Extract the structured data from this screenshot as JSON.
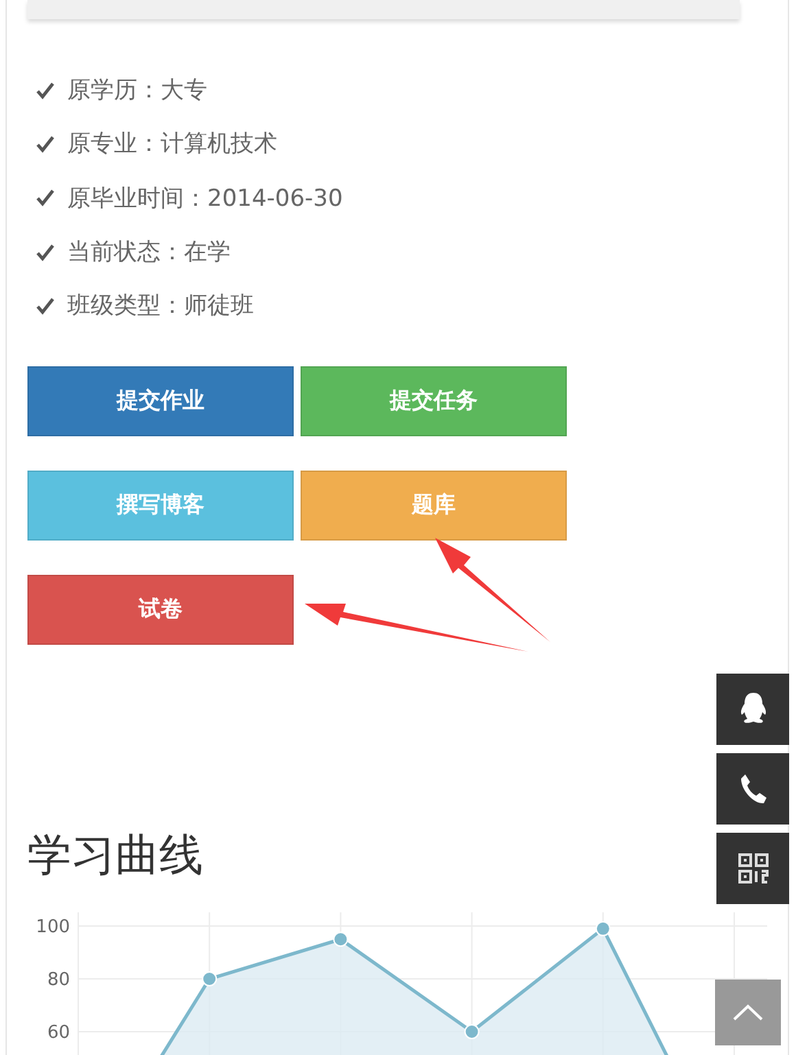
{
  "info_items": [
    "原学历：大专",
    "原专业：计算机技术",
    "原毕业时间：2014-06-30",
    "当前状态：在学",
    "班级类型：师徒班"
  ],
  "buttons": [
    {
      "label": "提交作业",
      "color": "#337ab7"
    },
    {
      "label": "提交任务",
      "color": "#5cb85c"
    },
    {
      "label": "撰写博客",
      "color": "#5bc0de"
    },
    {
      "label": "题库",
      "color": "#f0ad4e"
    },
    {
      "label": "试卷",
      "color": "#d9534f"
    }
  ],
  "section_title": "学习曲线",
  "chart_data": {
    "type": "area",
    "values": [
      0,
      80,
      95,
      60,
      99,
      0
    ],
    "yticks": [
      60,
      80,
      100
    ],
    "ylim": [
      0,
      100
    ],
    "grid": true
  },
  "side_tools": [
    {
      "kind": "qq"
    },
    {
      "kind": "phone"
    },
    {
      "kind": "qrcode"
    }
  ],
  "back_to_top": {
    "kind": "chevron"
  }
}
